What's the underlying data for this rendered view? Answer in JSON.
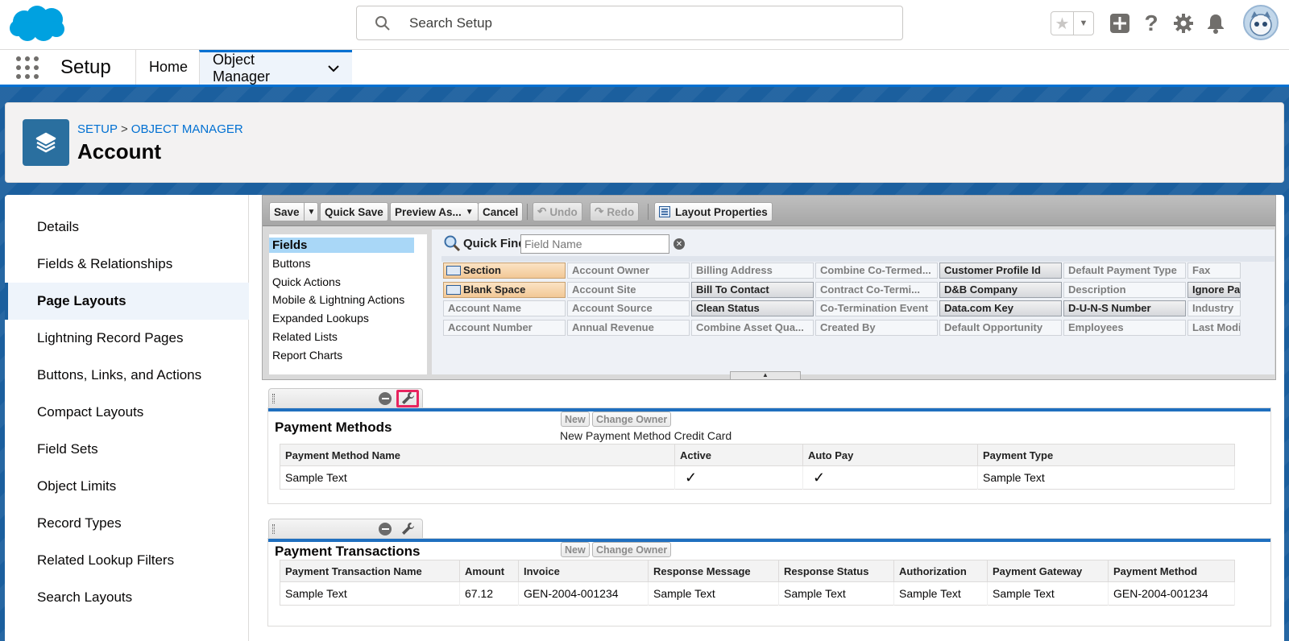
{
  "top": {
    "search_placeholder": "Search Setup",
    "icons": [
      "favorites-star-icon",
      "favorites-dropdown-icon",
      "global-actions-plus-icon",
      "help-icon",
      "setup-gear-icon",
      "notifications-bell-icon",
      "user-avatar"
    ]
  },
  "nav": {
    "app_name": "Setup",
    "tabs": [
      {
        "label": "Home",
        "active": false
      },
      {
        "label": "Object Manager",
        "active": true
      }
    ]
  },
  "header": {
    "breadcrumb": [
      "SETUP",
      "OBJECT MANAGER"
    ],
    "breadcrumb_sep": ">",
    "title": "Account"
  },
  "sidebar": {
    "items": [
      {
        "label": "Details"
      },
      {
        "label": "Fields & Relationships"
      },
      {
        "label": "Page Layouts",
        "active": true
      },
      {
        "label": "Lightning Record Pages"
      },
      {
        "label": "Buttons, Links, and Actions"
      },
      {
        "label": "Compact Layouts"
      },
      {
        "label": "Field Sets"
      },
      {
        "label": "Object Limits"
      },
      {
        "label": "Record Types"
      },
      {
        "label": "Related Lookup Filters"
      },
      {
        "label": "Search Layouts"
      }
    ]
  },
  "toolbar": {
    "save": "Save",
    "quick_save": "Quick Save",
    "preview_as": "Preview As...",
    "cancel": "Cancel",
    "undo": "Undo",
    "redo": "Redo",
    "layout_properties": "Layout Properties"
  },
  "palette": {
    "categories": [
      "Fields",
      "Buttons",
      "Quick Actions",
      "Mobile & Lightning Actions",
      "Expanded Lookups",
      "Related Lists",
      "Report Charts"
    ],
    "quick_find_label": "Quick Find",
    "quick_find_placeholder": "Field Name",
    "columns": [
      [
        {
          "label": "Section",
          "kind": "special"
        },
        {
          "label": "Blank Space",
          "kind": "special"
        },
        {
          "label": "Account Name",
          "kind": "available"
        },
        {
          "label": "Account Number",
          "kind": "available"
        }
      ],
      [
        {
          "label": "Account Owner",
          "kind": "available"
        },
        {
          "label": "Account Site",
          "kind": "available"
        },
        {
          "label": "Account Source",
          "kind": "available"
        },
        {
          "label": "Annual Revenue",
          "kind": "available"
        }
      ],
      [
        {
          "label": "Billing Address",
          "kind": "available"
        },
        {
          "label": "Bill To Contact",
          "kind": "used"
        },
        {
          "label": "Clean Status",
          "kind": "used"
        },
        {
          "label": "Combine Asset Qua...",
          "kind": "available"
        }
      ],
      [
        {
          "label": "Combine Co-Termed...",
          "kind": "available"
        },
        {
          "label": "Contract Co-Termi...",
          "kind": "available"
        },
        {
          "label": "Co-Termination Event",
          "kind": "available"
        },
        {
          "label": "Created By",
          "kind": "available"
        }
      ],
      [
        {
          "label": "Customer Profile Id",
          "kind": "used"
        },
        {
          "label": "D&B Company",
          "kind": "used"
        },
        {
          "label": "Data.com Key",
          "kind": "used"
        },
        {
          "label": "Default Opportunity",
          "kind": "available"
        }
      ],
      [
        {
          "label": "Default Payment Type",
          "kind": "available"
        },
        {
          "label": "Description",
          "kind": "available"
        },
        {
          "label": "D-U-N-S Number",
          "kind": "used"
        },
        {
          "label": "Employees",
          "kind": "available"
        }
      ],
      [
        {
          "label": "Fax",
          "kind": "available"
        },
        {
          "label": "Ignore Par",
          "kind": "used"
        },
        {
          "label": "Industry",
          "kind": "available"
        },
        {
          "label": "Last Modif",
          "kind": "available"
        }
      ]
    ]
  },
  "related_lists": [
    {
      "title": "Payment Methods",
      "new_label": "New",
      "change_owner_label": "Change Owner",
      "note": "New Payment Method Credit Card",
      "columns": [
        "Payment Method Name",
        "Active",
        "Auto Pay",
        "Payment Type"
      ],
      "row": [
        "Sample Text",
        "✓",
        "✓",
        "Sample Text"
      ]
    },
    {
      "title": "Payment Transactions",
      "new_label": "New",
      "change_owner_label": "Change Owner",
      "note": "",
      "columns": [
        "Payment Transaction Name",
        "Amount",
        "Invoice",
        "Response Message",
        "Response Status",
        "Authorization",
        "Payment Gateway",
        "Payment Method"
      ],
      "row": [
        "Sample Text",
        "67.12",
        "GEN-2004-001234",
        "Sample Text",
        "Sample Text",
        "Sample Text",
        "Sample Text",
        "GEN-2004-001234"
      ]
    }
  ]
}
